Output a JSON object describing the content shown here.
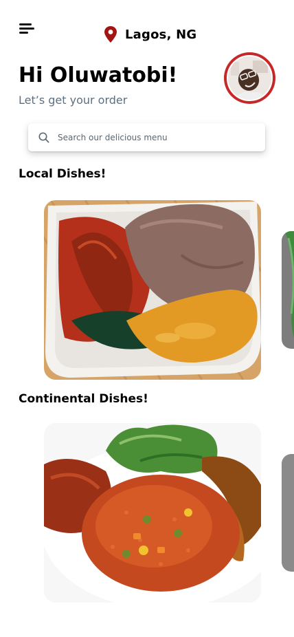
{
  "header": {
    "location": "Lagos, NG",
    "menu_icon": "menu-icon",
    "location_icon": "map-pin-icon",
    "pin_color": "#a31515"
  },
  "greeting": {
    "title": "Hi Oluwatobi!",
    "subtitle": "Let’s get your order"
  },
  "profile": {
    "ring_color": "#c62828"
  },
  "search": {
    "placeholder": "Search our delicious menu",
    "icon": "search-icon"
  },
  "sections": [
    {
      "title": "Local Dishes!"
    },
    {
      "title": "Continental Dishes!"
    }
  ]
}
